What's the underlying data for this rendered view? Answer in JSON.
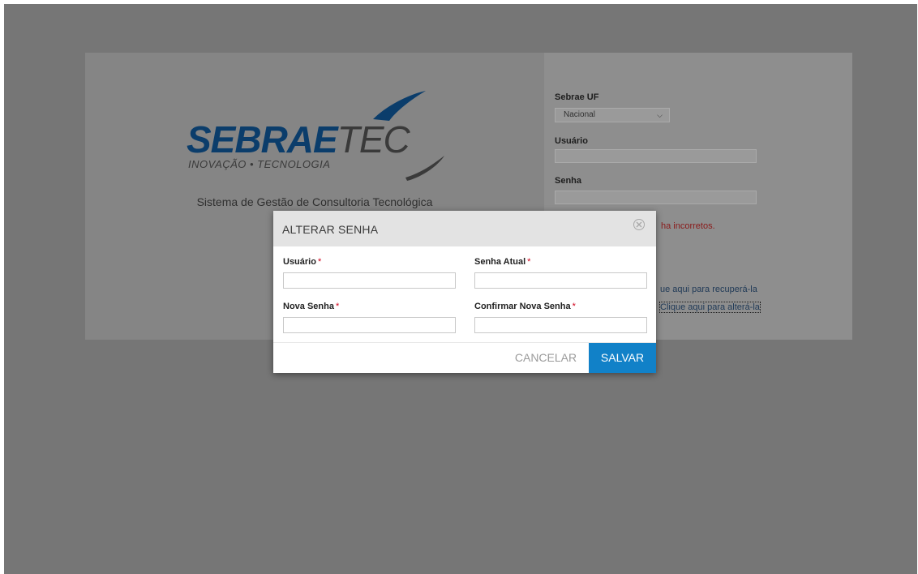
{
  "brand": {
    "logo_main": "SEBRAE",
    "logo_tec": "TEC",
    "logo_sub": "INOVAÇÃO • TECNOLOGIA",
    "tagline": "Sistema de Gestão de Consultoria Tecnológica",
    "logo_color": "#0b3d6b"
  },
  "login": {
    "uf_label": "Sebrae UF",
    "uf_selected": "Nacional",
    "user_label": "Usuário",
    "user_value": "",
    "password_label": "Senha",
    "password_value": "",
    "error_partial": "ha incorretos.",
    "recover_link_partial": "ue aqui para recuperá-la",
    "change_link_partial": "Clique aqui para alterá-la",
    "error_color": "#8a1a1a"
  },
  "modal": {
    "title": "ALTERAR SENHA",
    "close_icon": "close-circle-icon",
    "fields": {
      "user_label": "Usuário",
      "current_password_label": "Senha Atual",
      "new_password_label": "Nova Senha",
      "confirm_password_label": "Confirmar Nova Senha",
      "required_mark": "*"
    },
    "cancel_label": "CANCELAR",
    "save_label": "SALVAR",
    "primary_color": "#1181c8"
  }
}
